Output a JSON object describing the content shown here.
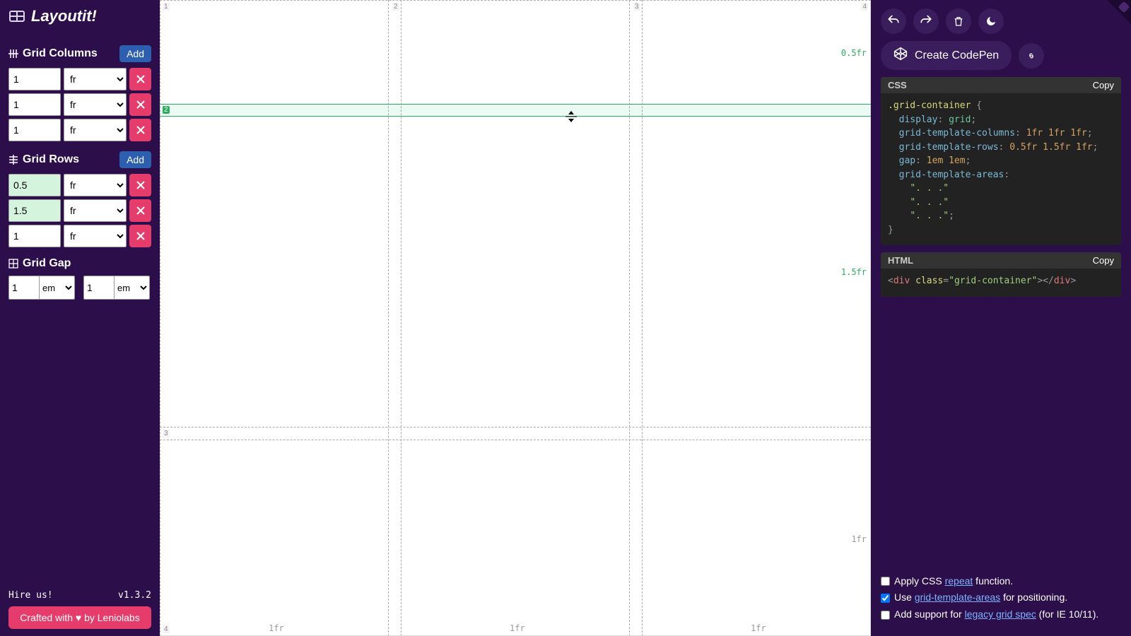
{
  "app": {
    "title": "Layoutit!"
  },
  "sidebar": {
    "columns": {
      "label": "Grid Columns",
      "add": "Add",
      "tracks": [
        {
          "value": "1",
          "unit": "fr"
        },
        {
          "value": "1",
          "unit": "fr"
        },
        {
          "value": "1",
          "unit": "fr"
        }
      ]
    },
    "rows": {
      "label": "Grid Rows",
      "add": "Add",
      "tracks": [
        {
          "value": "0.5",
          "unit": "fr",
          "active": true
        },
        {
          "value": "1.5",
          "unit": "fr",
          "active": true
        },
        {
          "value": "1",
          "unit": "fr"
        }
      ]
    },
    "gap": {
      "label": "Grid Gap",
      "col": {
        "value": "1",
        "unit": "em"
      },
      "row": {
        "value": "1",
        "unit": "em"
      }
    },
    "footer": {
      "hire": "Hire us!",
      "version": "v1.3.2",
      "crafted": "Crafted with ♥ by Leniolabs"
    }
  },
  "canvas": {
    "col_lines": [
      "1",
      "2",
      "3",
      "4"
    ],
    "row_lines": [
      "1",
      "2",
      "3",
      "4"
    ],
    "col_fr": [
      "1fr",
      "1fr",
      "1fr"
    ],
    "row_fr": [
      "0.5fr",
      "1.5fr",
      "1fr"
    ],
    "active_row_line": 2
  },
  "right": {
    "codepen": "Create CodePen",
    "css": {
      "title": "CSS",
      "copy": "Copy",
      "selector": ".grid-container",
      "display": "grid",
      "cols": "1fr 1fr 1fr",
      "rows": "0.5fr 1.5fr 1fr",
      "gap": "1em 1em",
      "areas": [
        "\". . .\"",
        "\". . .\"",
        "\". . .\""
      ]
    },
    "html": {
      "title": "HTML",
      "copy": "Copy",
      "tag": "div",
      "class_attr": "class",
      "class_val": "grid-container"
    },
    "options": {
      "repeat_pre": "Apply CSS ",
      "repeat_link": "repeat",
      "repeat_post": " function.",
      "areas_pre": "Use ",
      "areas_link": "grid-template-areas",
      "areas_post": " for positioning.",
      "legacy_pre": "Add support for ",
      "legacy_link": "legacy grid spec",
      "legacy_post": " (for IE 10/11).",
      "repeat_checked": false,
      "areas_checked": true,
      "legacy_checked": false
    }
  }
}
